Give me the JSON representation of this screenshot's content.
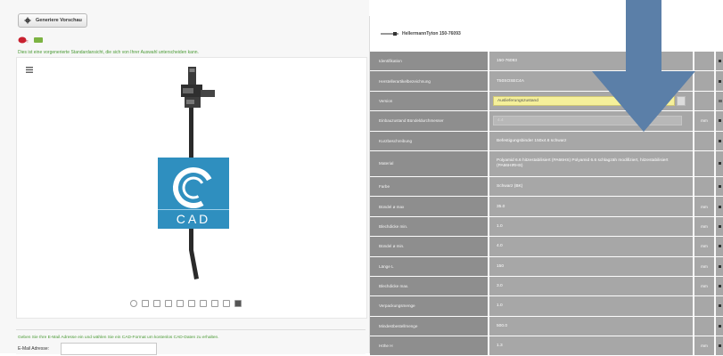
{
  "toolbar": {
    "preview_label": "Generiere Vorschau",
    "gear_icon": "gear-icon"
  },
  "left": {
    "notice": "Dies ist eine vorgenerierte Standardansicht, die sich von Ihrer Auswahl unterscheiden kann.",
    "email_notice": "Geben Sie Ihre E-Mail Adresse ein und wählen Sie ein CAD-Format um kostenlos CAD-Daten zu erhalten.",
    "email_label": "E-Mail Adresse:",
    "email_value": ""
  },
  "cad_logo": {
    "text": "CAD",
    "color": "#2f8fbf"
  },
  "product": {
    "title": "HellermannTyton 150-76093"
  },
  "properties": [
    {
      "label": "Identifikation",
      "value": "150-76093",
      "unit": ""
    },
    {
      "label": "Herstellerartikelbezeichnung",
      "value": "T50SOSEC4A",
      "unit": ""
    },
    {
      "label": "Version",
      "value": "Auslieferungszustand",
      "unit": "",
      "type": "select"
    },
    {
      "label": "Einbauzustand Bündeldurchmesser",
      "value": "4.4",
      "unit": "mm",
      "type": "disabled"
    },
    {
      "label": "Kurzbeschreibung",
      "value": "Befestigungsbinder 150x4.6 schwarz",
      "unit": ""
    },
    {
      "label": "Material",
      "value": "Polyamid 6.6 hitzestabilisiert (PA66HS) Polyamid 6.6 schlagzäh modifiziert, hitzestabilisiert (PA66HIRHS)",
      "unit": ""
    },
    {
      "label": "Farbe",
      "value": "Schwarz (BK)",
      "unit": ""
    },
    {
      "label": "Bündel ø max",
      "value": "35.0",
      "unit": "mm"
    },
    {
      "label": "Blechdicke min.",
      "value": "1.0",
      "unit": "mm"
    },
    {
      "label": "Bündel ø min.",
      "value": "4.0",
      "unit": "mm"
    },
    {
      "label": "Länge L",
      "value": "150",
      "unit": "mm"
    },
    {
      "label": "Blechdicke max.",
      "value": "3.0",
      "unit": "mm"
    },
    {
      "label": "Verpackungsmenge",
      "value": "1.0",
      "unit": ""
    },
    {
      "label": "Mindestbestellmenge",
      "value": "500.0",
      "unit": ""
    },
    {
      "label": "Höhe H",
      "value": "1.3",
      "unit": "mm"
    }
  ],
  "colors": {
    "label_bg": "#8e8e8e",
    "value_bg": "#a7a7a7",
    "highlight": "#f5f09a",
    "arrow": "#5b7fa8",
    "notice": "#4a9a35"
  }
}
